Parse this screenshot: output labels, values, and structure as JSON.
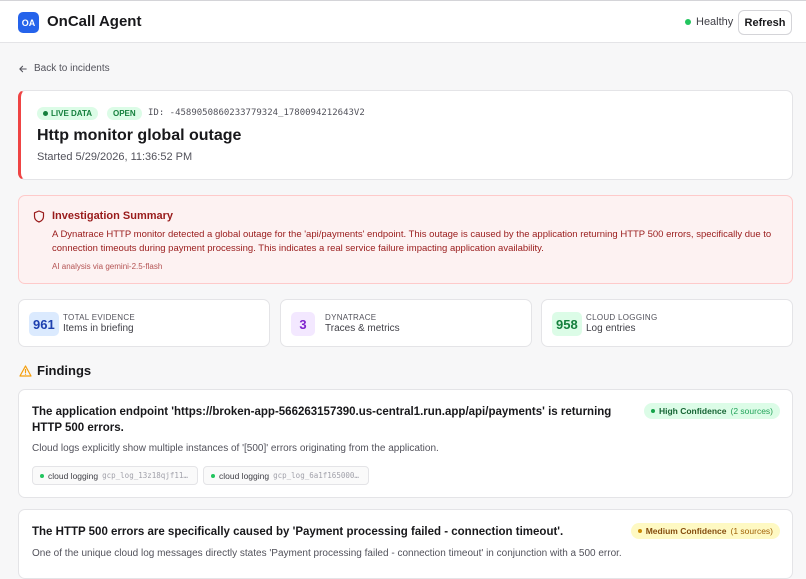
{
  "header": {
    "logo_text": "OA",
    "app_title": "OnCall Agent",
    "status_text": "Healthy",
    "status_color": "#22c55e",
    "refresh_label": "Refresh"
  },
  "nav": {
    "back_label": "Back to incidents"
  },
  "incident": {
    "live_badge": "LIVE DATA",
    "state_badge": "OPEN",
    "id_text": "ID: -4589050860233779324_1780094212643V2",
    "title": "Http monitor global outage",
    "started": "Started 5/29/2026, 11:36:52 PM",
    "accent_color": "#ef4444"
  },
  "summary": {
    "title": "Investigation Summary",
    "text": "A Dynatrace HTTP monitor detected a global outage for the 'api/payments' endpoint. This outage is caused by the application returning HTTP 500 errors, specifically due to connection timeouts during payment processing. This indicates a real service failure impacting application availability.",
    "note": "AI analysis via gemini-2.5-flash"
  },
  "stats": [
    {
      "value": "961",
      "label": "TOTAL EVIDENCE",
      "sub": "Items in briefing",
      "bg": "#dbeafe",
      "fg": "#1e40af"
    },
    {
      "value": "3",
      "label": "DYNATRACE",
      "sub": "Traces & metrics",
      "bg": "#f3e8ff",
      "fg": "#7e22ce"
    },
    {
      "value": "958",
      "label": "CLOUD LOGGING",
      "sub": "Log entries",
      "bg": "#dcfce7",
      "fg": "#15803d"
    }
  ],
  "findings": {
    "heading": "Findings",
    "items": [
      {
        "title": "The application endpoint 'https://broken-app-566263157390.us-central1.run.app/api/payments' is returning HTTP 500 errors.",
        "confidence": "High Confidence",
        "sources": "(2 sources)",
        "description": "Cloud logs explicitly show multiple instances of '[500]' errors originating from the application.",
        "chips": [
          {
            "label": "cloud logging",
            "code": "gcp_log_13z18qjf11…"
          },
          {
            "label": "cloud logging",
            "code": "gcp_log_6a1f165000…"
          }
        ]
      },
      {
        "title": "The HTTP 500 errors are specifically caused by 'Payment processing failed - connection timeout'.",
        "confidence": "Medium Confidence",
        "sources": "(1 sources)",
        "description": "One of the unique cloud log messages directly states 'Payment processing failed - connection timeout' in conjunction with a 500 error."
      }
    ]
  }
}
